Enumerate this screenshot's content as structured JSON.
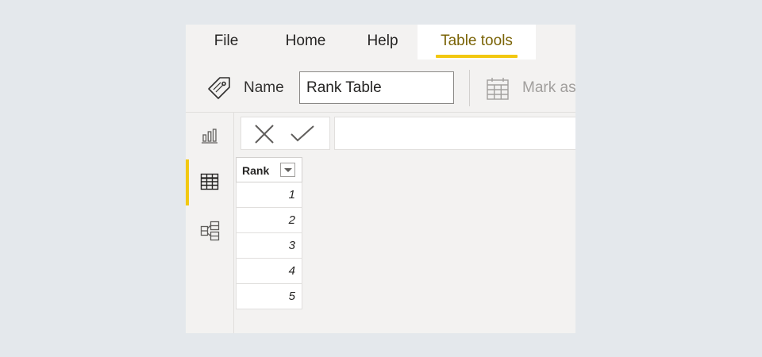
{
  "menu": {
    "tabs": [
      {
        "label": "File"
      },
      {
        "label": "Home"
      },
      {
        "label": "Help"
      },
      {
        "label": "Table tools",
        "active": true
      }
    ]
  },
  "ribbon": {
    "name_label": "Name",
    "name_value": "Rank Table",
    "mark_as_label": "Mark as"
  },
  "colors": {
    "accent": "#f2c811",
    "active_tab_text": "#7a6306",
    "app_background": "#f3f2f1",
    "page_background": "#e4e8ec"
  },
  "left_nav": {
    "items": [
      {
        "icon": "report-view-icon"
      },
      {
        "icon": "data-view-icon",
        "active": true
      },
      {
        "icon": "model-view-icon"
      }
    ]
  },
  "formula_bar": {
    "cancel_icon": "close-icon",
    "commit_icon": "checkmark-icon",
    "value": ""
  },
  "table": {
    "columns": [
      {
        "header": "Rank",
        "icon": "filter-dropdown-icon"
      }
    ],
    "rows": [
      {
        "rank": "1"
      },
      {
        "rank": "2"
      },
      {
        "rank": "3"
      },
      {
        "rank": "4"
      },
      {
        "rank": "5"
      }
    ]
  }
}
